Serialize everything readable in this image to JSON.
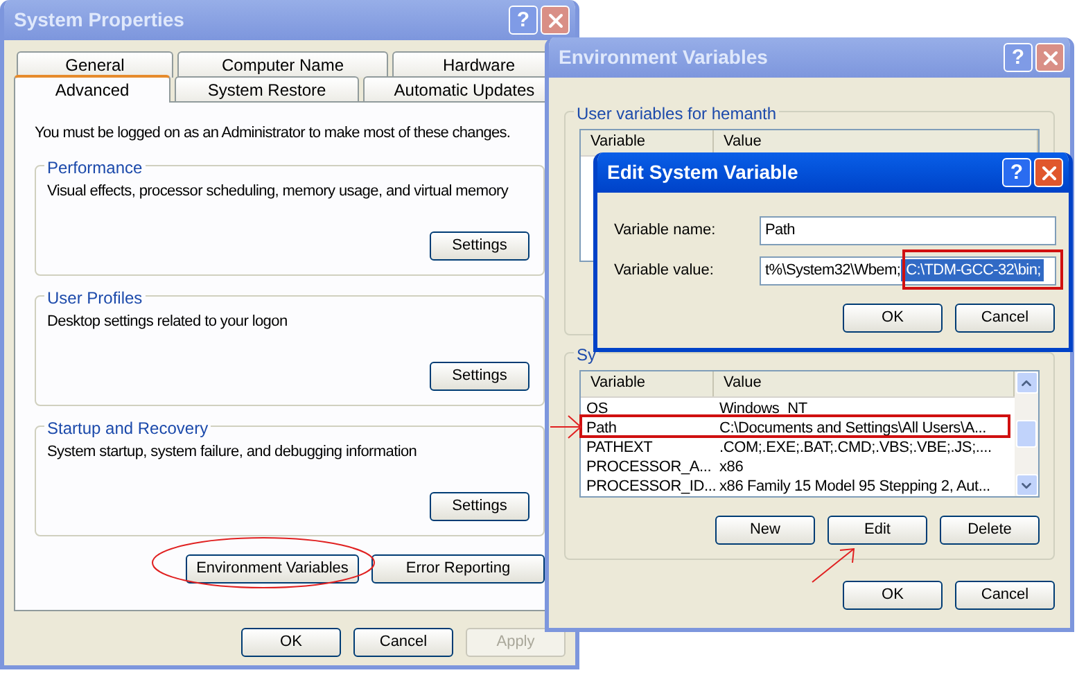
{
  "windows": [
    {
      "kind": "system_properties",
      "title": "System Properties",
      "active": false,
      "help": "?",
      "tab_rows": [
        [
          {
            "label": "General",
            "selected": false
          },
          {
            "label": "Computer Name",
            "selected": false
          },
          {
            "label": "Hardware",
            "selected": false
          }
        ],
        [
          {
            "label": "Advanced",
            "selected": true
          },
          {
            "label": "System Restore",
            "selected": false
          },
          {
            "label": "Automatic Updates",
            "selected": false
          }
        ]
      ],
      "notice": "You must be logged on as an Administrator to make most of these changes.",
      "groups": [
        {
          "title": "Performance",
          "description": "Visual effects, processor scheduling, memory usage, and virtual memory",
          "button": "Settings"
        },
        {
          "title": "User Profiles",
          "description": "Desktop settings related to your logon",
          "button": "Settings"
        },
        {
          "title": "Startup and Recovery",
          "description": "System startup, system failure, and debugging information",
          "button": "Settings"
        }
      ],
      "panel_buttons": [
        {
          "label": "Environment Variables"
        },
        {
          "label": "Error Reporting"
        }
      ],
      "buttons": [
        {
          "label": "OK",
          "disabled": false
        },
        {
          "label": "Cancel",
          "disabled": false
        },
        {
          "label": "Apply",
          "disabled": true
        }
      ]
    },
    {
      "kind": "environment_variables",
      "title": "Environment Variables",
      "active": false,
      "help": "?",
      "user_group": {
        "title": "User variables for hemanth",
        "columns": [
          "Variable",
          "Value"
        ]
      },
      "system_group": {
        "title": "Sy",
        "columns": [
          "Variable",
          "Value"
        ],
        "rows": [
          [
            "OS",
            "Windows_NT"
          ],
          [
            "Path",
            "C:\\Documents and Settings\\All Users\\A..."
          ],
          [
            "PATHEXT",
            ".COM;.EXE;.BAT;.CMD;.VBS;.VBE;.JS;...."
          ],
          [
            "PROCESSOR_A...",
            "x86"
          ],
          [
            "PROCESSOR_ID...",
            "x86 Family 15 Model 95 Stepping 2, Aut..."
          ]
        ],
        "buttons": [
          {
            "label": "New"
          },
          {
            "label": "Edit"
          },
          {
            "label": "Delete"
          }
        ]
      },
      "buttons": [
        {
          "label": "OK",
          "disabled": false
        },
        {
          "label": "Cancel",
          "disabled": false
        }
      ]
    },
    {
      "kind": "edit_variable",
      "title": "Edit System Variable",
      "active": true,
      "help": "?",
      "fields": [
        {
          "label": "Variable name:",
          "value": "Path"
        },
        {
          "label": "Variable value:",
          "value": "t%\\System32\\Wbem;",
          "selection": "C:\\TDM-GCC-32\\bin;"
        }
      ],
      "buttons": [
        {
          "label": "OK",
          "disabled": false
        },
        {
          "label": "Cancel",
          "disabled": false
        }
      ]
    }
  ]
}
